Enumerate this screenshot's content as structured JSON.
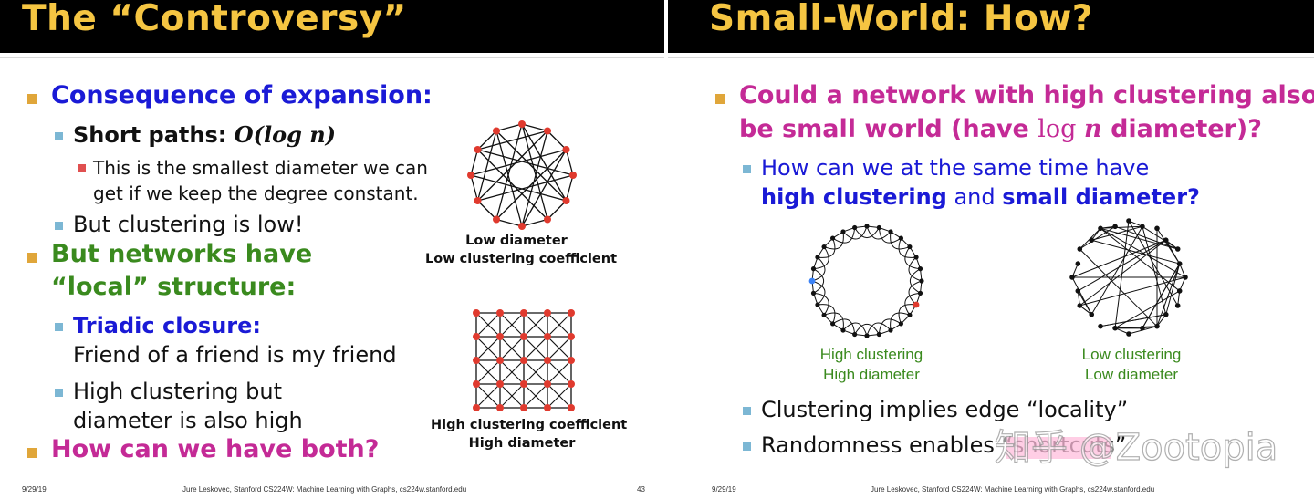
{
  "left_slide": {
    "title": "The “Controversy”",
    "b1": "Consequence of expansion:",
    "b1_1_prefix": "Short paths: ",
    "b1_1_math": "O(log n)",
    "b1_1_1_line1": "This is the smallest diameter we can",
    "b1_1_1_line2": "get if we keep the degree constant.",
    "b1_2": "But clustering is low!",
    "b2_line1": "But networks have",
    "b2_line2": "“local” structure:",
    "b2_1_label": "Triadic closure:",
    "b2_1_line2": "Friend of a friend is my friend",
    "b2_2_line1": "High clustering but",
    "b2_2_line2": "diameter is also high",
    "b3": "How can we have both?",
    "fig1_caption_line1": "Low diameter",
    "fig1_caption_line2": "Low clustering coefficient",
    "fig2_caption_line1": "High clustering coefficient",
    "fig2_caption_line2": "High diameter",
    "footer_date": "9/29/19",
    "footer_credit": "Jure Leskovec, Stanford CS224W: Machine Learning with Graphs, cs224w.stanford.edu",
    "footer_page": "43"
  },
  "right_slide": {
    "title": "Small-World: How?",
    "q_line1": "Could a network with high clustering also",
    "q_line2_a": "be small world (have ",
    "q_line2_log": "log",
    "q_line2_n": "n",
    "q_line2_b": " diameter)?",
    "sub_line1": "How can we at the same time have",
    "sub_bold1": "high clustering",
    "sub_and": " and ",
    "sub_bold2": "small diameter?",
    "fig1_caption_line1": "High clustering",
    "fig1_caption_line2": "High diameter",
    "fig2_caption_line1": "Low clustering",
    "fig2_caption_line2": "Low diameter",
    "b1": "Clustering implies edge “locality”",
    "b2": "Randomness enables “shortcuts”",
    "footer_date": "9/29/19",
    "footer_credit": "Jure Leskovec, Stanford CS224W: Machine Learning with Graphs, cs224w.stanford.edu"
  },
  "watermark": "知乎 @Zootopia",
  "colors": {
    "title": "#f5c542",
    "blue_text": "#1a1ad6",
    "green_text": "#3a8a1e",
    "magenta_text": "#c42a96",
    "node_red": "#e03a2e",
    "node_blue": "#3b82f6",
    "bullet_gold": "#e0a63a",
    "bullet_blue": "#7cb7d4",
    "bullet_red": "#e05050"
  }
}
